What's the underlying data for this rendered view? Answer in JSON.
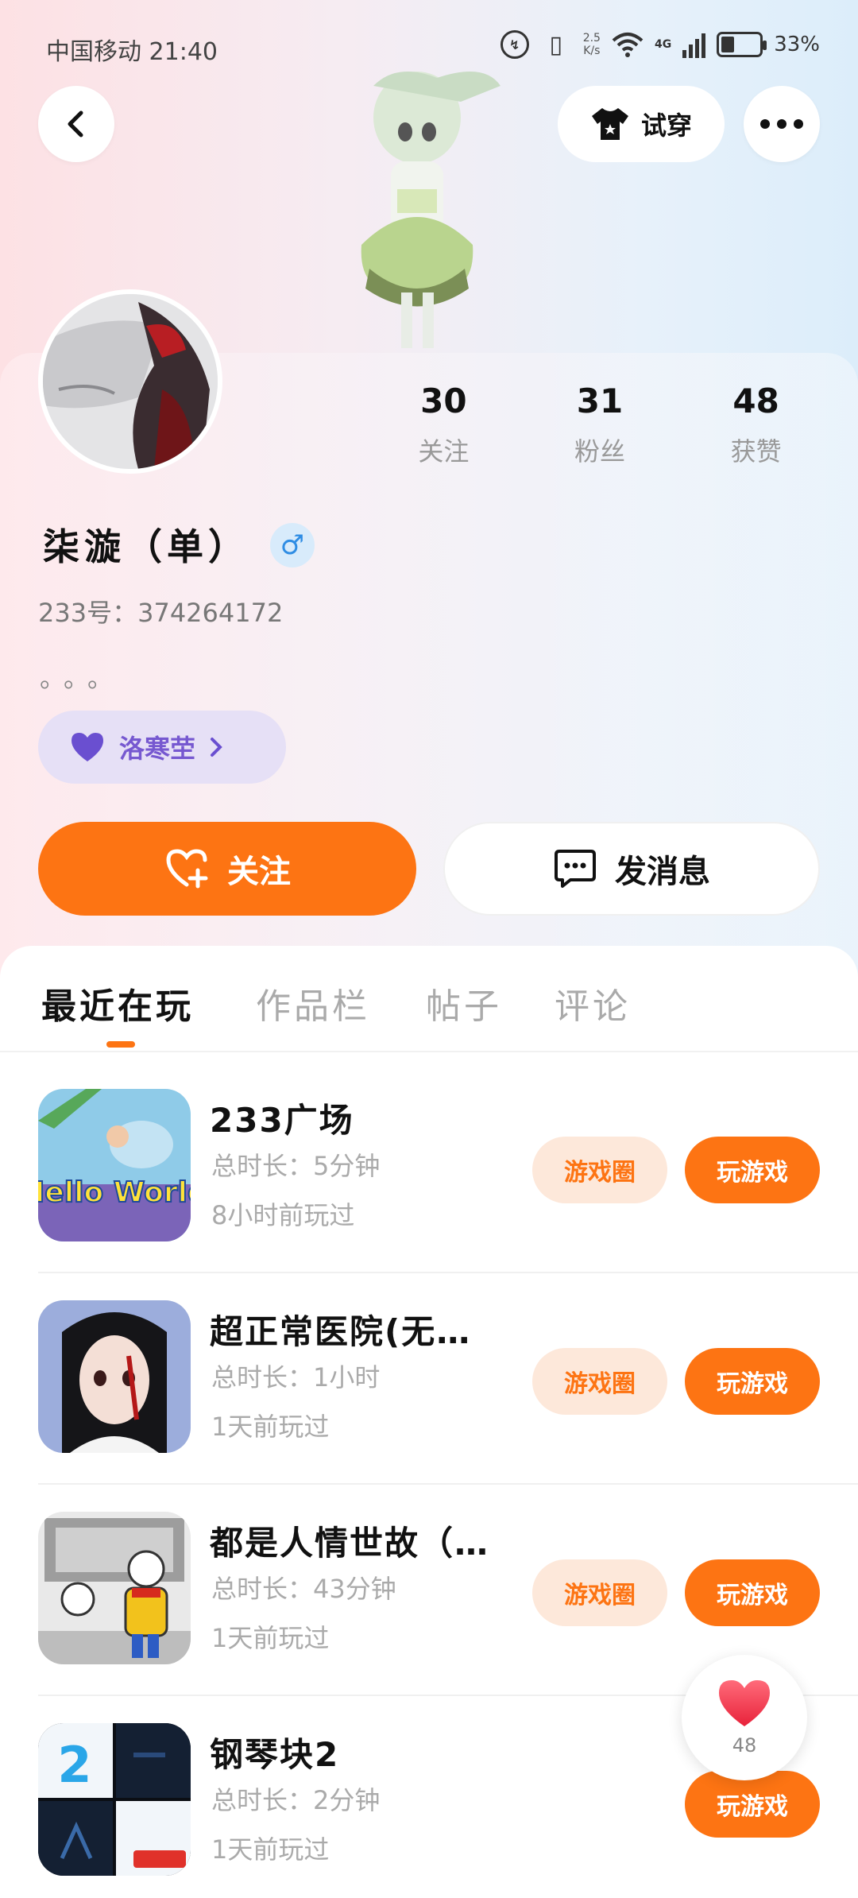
{
  "status_bar": {
    "carrier_time": "中国移动 21:40",
    "speed_value": "2.5",
    "speed_unit": "K/s",
    "network": "4G",
    "battery": "33%"
  },
  "header": {
    "back_icon": "chevron-left-icon",
    "tryon_label": "试穿",
    "more_icon": "more-dots-icon"
  },
  "profile": {
    "username": "柒漩（单）",
    "gender_symbol": "♂",
    "uid_label": "233号：",
    "uid_value": "374264172",
    "bio": "。。。",
    "tag_label": "洛寒茔",
    "stats": [
      {
        "value": "30",
        "label": "关注"
      },
      {
        "value": "31",
        "label": "粉丝"
      },
      {
        "value": "48",
        "label": "获赞"
      }
    ]
  },
  "actions": {
    "follow_label": "关注",
    "message_label": "发消息"
  },
  "tabs": [
    "最近在玩",
    "作品栏",
    "帖子",
    "评论"
  ],
  "games": [
    {
      "title": "233广场",
      "duration": "总时长：5分钟",
      "last_played": "8小时前玩过",
      "circle_label": "游戏圈",
      "play_label": "玩游戏",
      "icon_text": "Hello World"
    },
    {
      "title": "超正常医院(无…",
      "duration": "总时长：1小时",
      "last_played": "1天前玩过",
      "circle_label": "游戏圈",
      "play_label": "玩游戏"
    },
    {
      "title": "都是人情世故（…",
      "duration": "总时长：43分钟",
      "last_played": "1天前玩过",
      "circle_label": "游戏圈",
      "play_label": "玩游戏"
    },
    {
      "title": "钢琴块2",
      "duration": "总时长：2分钟",
      "last_played": "1天前玩过",
      "play_label": "玩游戏",
      "icon_text": "2"
    }
  ],
  "like_float": {
    "count": "48"
  },
  "colors": {
    "accent": "#fd7413",
    "tag_purple": "#7658d0",
    "gender_blue": "#2f8de4"
  }
}
